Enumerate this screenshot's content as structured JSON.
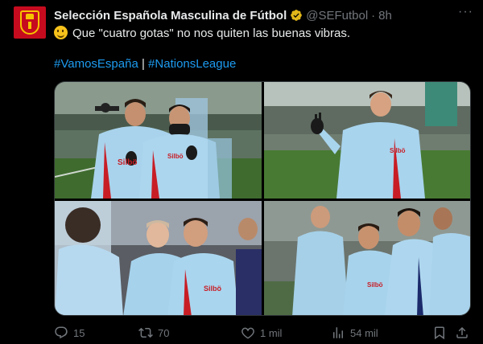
{
  "tweet": {
    "author_name": "Selección Española Masculina de Fútbol",
    "handle": "@SEFutbol",
    "separator": "·",
    "time": "8h",
    "more": "···",
    "text": "Que \"cuatro gotas\" no nos quiten las buenas vibras.",
    "emoji": "grinning-face",
    "hashtags": [
      "#VamosEspaña",
      "#NationsLeague"
    ],
    "hashtag_separator": "|"
  },
  "actions": {
    "replies": "15",
    "reposts": "70",
    "likes": "1 mil",
    "views": "54 mil"
  },
  "photos": [
    {
      "sponsor": "Silbö",
      "scene": "two players posing, thumbs up"
    },
    {
      "sponsor": "Silbö",
      "scene": "player waving on pitch"
    },
    {
      "sponsor": "Silbö",
      "scene": "two players smiling"
    },
    {
      "sponsor": "Silbö",
      "scene": "group of players training"
    }
  ],
  "colors": {
    "background": "#000000",
    "text": "#e7e9ea",
    "muted": "#71767b",
    "link": "#1d9bf0",
    "verified": "#e2b719",
    "avatar": "#c60b1e"
  }
}
